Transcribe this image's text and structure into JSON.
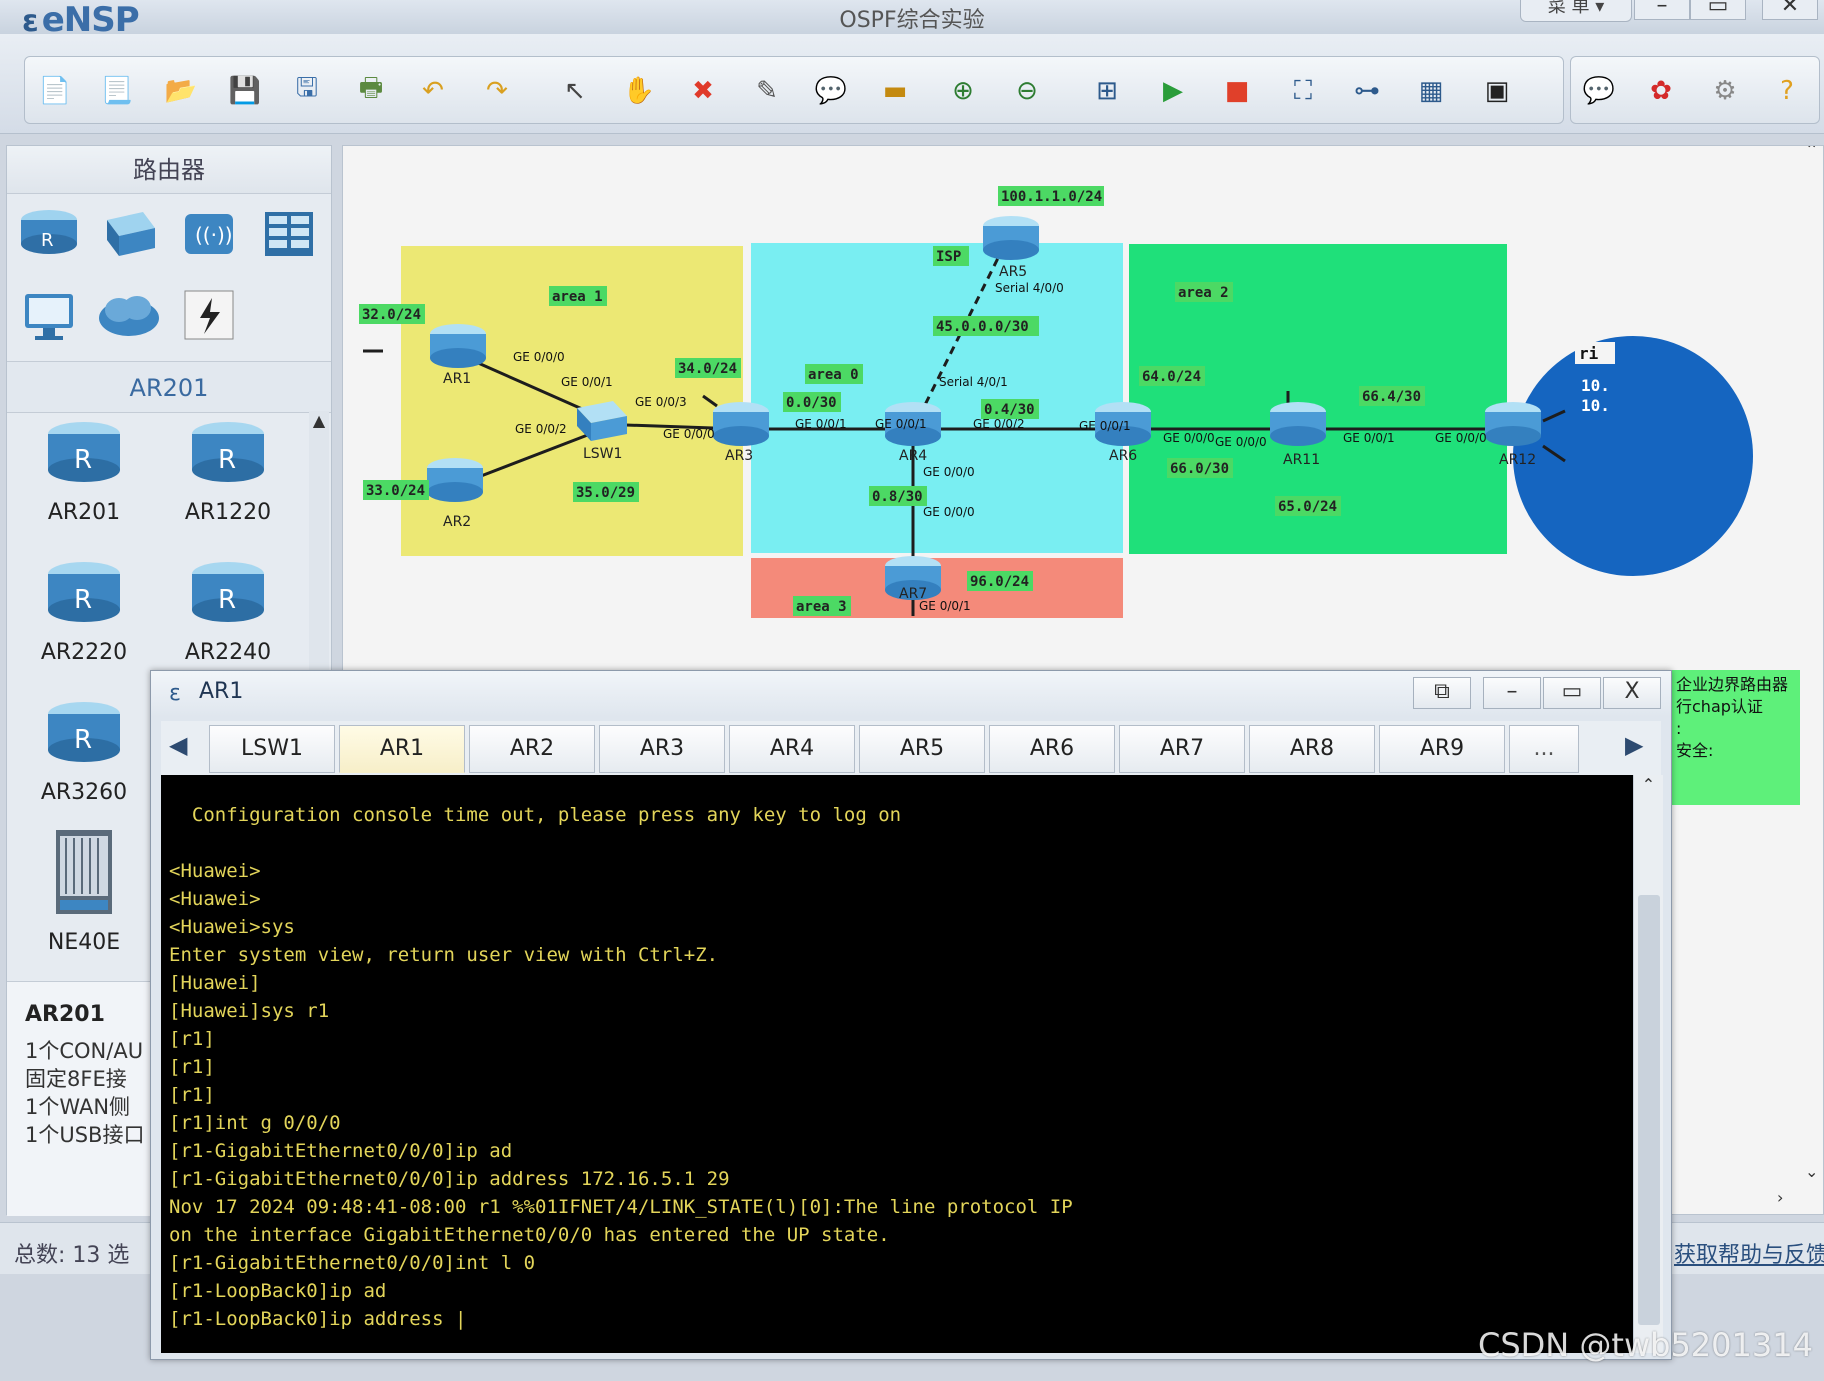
{
  "app": {
    "name": "eNSP",
    "title": "OSPF综合实验",
    "menu_label": "菜 单"
  },
  "toolbar": {
    "icons": [
      "new-topology",
      "new-lab",
      "open",
      "save",
      "save-as",
      "print",
      "undo",
      "redo",
      "select",
      "pan",
      "delete",
      "delete-link",
      "text",
      "rectangle",
      "zoom-in",
      "zoom-out",
      "fit",
      "start-all",
      "stop-all",
      "capture",
      "topology",
      "grid",
      "cli",
      "chat",
      "huawei-logo",
      "settings",
      "help"
    ]
  },
  "left_panel": {
    "category_title": "路由器",
    "category_icons": [
      "router-icon",
      "switch-icon",
      "wireless-icon",
      "firewall-icon",
      "pc-icon",
      "cloud-icon",
      "link-icon"
    ],
    "sub_title": "AR201",
    "devices": [
      {
        "label": "AR201"
      },
      {
        "label": "AR1220"
      },
      {
        "label": "AR2220"
      },
      {
        "label": "AR2240"
      },
      {
        "label": "AR3260"
      },
      {
        "label": "NE40E"
      }
    ],
    "info": {
      "title": "AR201",
      "lines": [
        "1个CON/AU",
        "固定8FE接",
        "1个WAN侧",
        "1个USB接口"
      ]
    }
  },
  "status_bar": {
    "left": "总数: 13  选",
    "right": "获取帮助与反馈"
  },
  "topology": {
    "areas": [
      {
        "name": "area 1",
        "color": "#ece874"
      },
      {
        "name": "area 0",
        "color": "#79eef2"
      },
      {
        "name": "area 2",
        "color": "#1fe07a"
      },
      {
        "name": "area 3",
        "color": "#f48a7a"
      }
    ],
    "nodes": [
      "AR1",
      "AR2",
      "LSW1",
      "AR3",
      "AR4",
      "AR5",
      "AR6",
      "AR7",
      "AR11",
      "AR12",
      "ISP"
    ],
    "subnet_labels": [
      "100.1.1.0/24",
      "ISP",
      "32.0/24",
      "33.0/24",
      "34.0/24",
      "35.0/29",
      "0.0/30",
      "45.0.0.0/30",
      "0.4/30",
      "0.8/30",
      "96.0/24",
      "64.0/24",
      "66.0/30",
      "66.4/30",
      "65.0/24",
      "area 1",
      "area 0",
      "area 2",
      "area 3"
    ],
    "port_labels": [
      "GE 0/0/0",
      "GE 0/0/1",
      "GE 0/0/2",
      "GE 0/0/3",
      "GE 0/0/0",
      "Serial 4/0/0",
      "Serial 4/0/1",
      "GE 0/0/1",
      "GE 0/0/1",
      "GE 0/0/2",
      "GE 0/0/1",
      "GE 0/0/0",
      "GE 0/0/0",
      "GE 0/0/0",
      "GE 0/0/1",
      "GE 0/0/0",
      "GE 0/0/0",
      "GE 0/0/1"
    ],
    "right_labels": [
      "ri",
      "10.",
      "10."
    ]
  },
  "right_note": {
    "lines": [
      "企业边界路由器",
      "行chap认证",
      ":",
      "",
      "安全:"
    ]
  },
  "console": {
    "title": "AR1",
    "tabs": [
      "LSW1",
      "AR1",
      "AR2",
      "AR3",
      "AR4",
      "AR5",
      "AR6",
      "AR7",
      "AR8",
      "AR9",
      "..."
    ],
    "active_tab": "AR1",
    "lines": [
      "  Configuration console time out, please press any key to log on",
      "",
      "<Huawei>",
      "<Huawei>",
      "<Huawei>sys",
      "Enter system view, return user view with Ctrl+Z.",
      "[Huawei]",
      "[Huawei]sys r1",
      "[r1]",
      "[r1]",
      "[r1]",
      "[r1]int g 0/0/0",
      "[r1-GigabitEthernet0/0/0]ip ad",
      "[r1-GigabitEthernet0/0/0]ip address 172.16.5.1 29",
      "Nov 17 2024 09:48:41-08:00 r1 %%01IFNET/4/LINK_STATE(l)[0]:The line protocol IP",
      "on the interface GigabitEthernet0/0/0 has entered the UP state.",
      "[r1-GigabitEthernet0/0/0]int l 0",
      "[r1-LoopBack0]ip ad",
      "[r1-LoopBack0]ip address |"
    ]
  },
  "watermark": "CSDN @twb5201314"
}
